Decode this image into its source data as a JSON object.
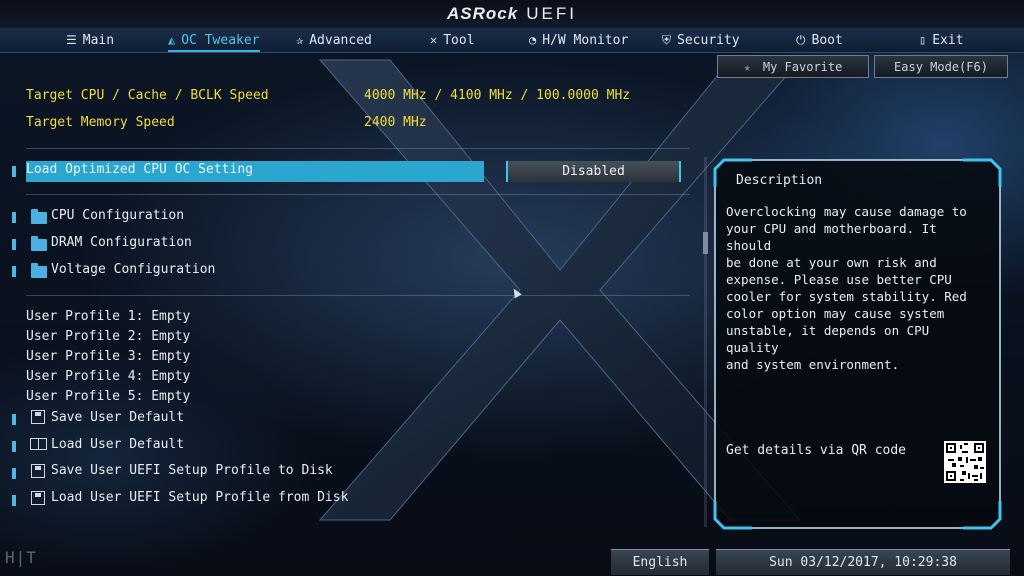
{
  "brand": {
    "name": "ASRock",
    "product": "UEFI"
  },
  "nav": [
    {
      "label": "Main",
      "icon": "list-icon"
    },
    {
      "label": "OC Tweaker",
      "icon": "rocket-icon",
      "active": true
    },
    {
      "label": "Advanced",
      "icon": "star-icon"
    },
    {
      "label": "Tool",
      "icon": "tools-icon"
    },
    {
      "label": "H/W Monitor",
      "icon": "monitor-icon"
    },
    {
      "label": "Security",
      "icon": "shield-icon"
    },
    {
      "label": "Boot",
      "icon": "power-icon"
    },
    {
      "label": "Exit",
      "icon": "exit-icon"
    }
  ],
  "buttons": {
    "favorite": "My Favorite",
    "easy_mode": "Easy Mode(F6)"
  },
  "targets": [
    {
      "label": "Target CPU / Cache / BCLK Speed",
      "value": "4000 MHz / 4100 MHz / 100.0000 MHz"
    },
    {
      "label": "Target Memory Speed",
      "value": "2400 MHz"
    }
  ],
  "selected_setting": {
    "label": "Load Optimized CPU OC Setting",
    "value": "Disabled"
  },
  "folders": [
    "CPU Configuration",
    "DRAM Configuration",
    "Voltage Configuration"
  ],
  "profiles": [
    "User Profile 1: Empty",
    "User Profile 2: Empty",
    "User Profile 3: Empty",
    "User Profile 4: Empty",
    "User Profile 5: Empty"
  ],
  "actions": [
    "Save User Default",
    "Load User Default",
    "Save User UEFI Setup Profile to Disk",
    "Load User UEFI Setup Profile from Disk"
  ],
  "description": {
    "title": "Description",
    "text": "Overclocking may cause damage to\nyour CPU and motherboard. It should\nbe done at your own risk and\nexpense. Please use better CPU\ncooler for system stability. Red\ncolor option may cause system\nunstable, it depends on CPU quality\nand system environment.",
    "qr_label": "Get details via QR code"
  },
  "footer": {
    "language": "English",
    "datetime": "Sun 03/12/2017, 10:29:38"
  },
  "watermark": "H|T",
  "colors": {
    "accent": "#34b4e8",
    "highlight": "#2ba6cf",
    "target_text": "#f4dc3b"
  }
}
